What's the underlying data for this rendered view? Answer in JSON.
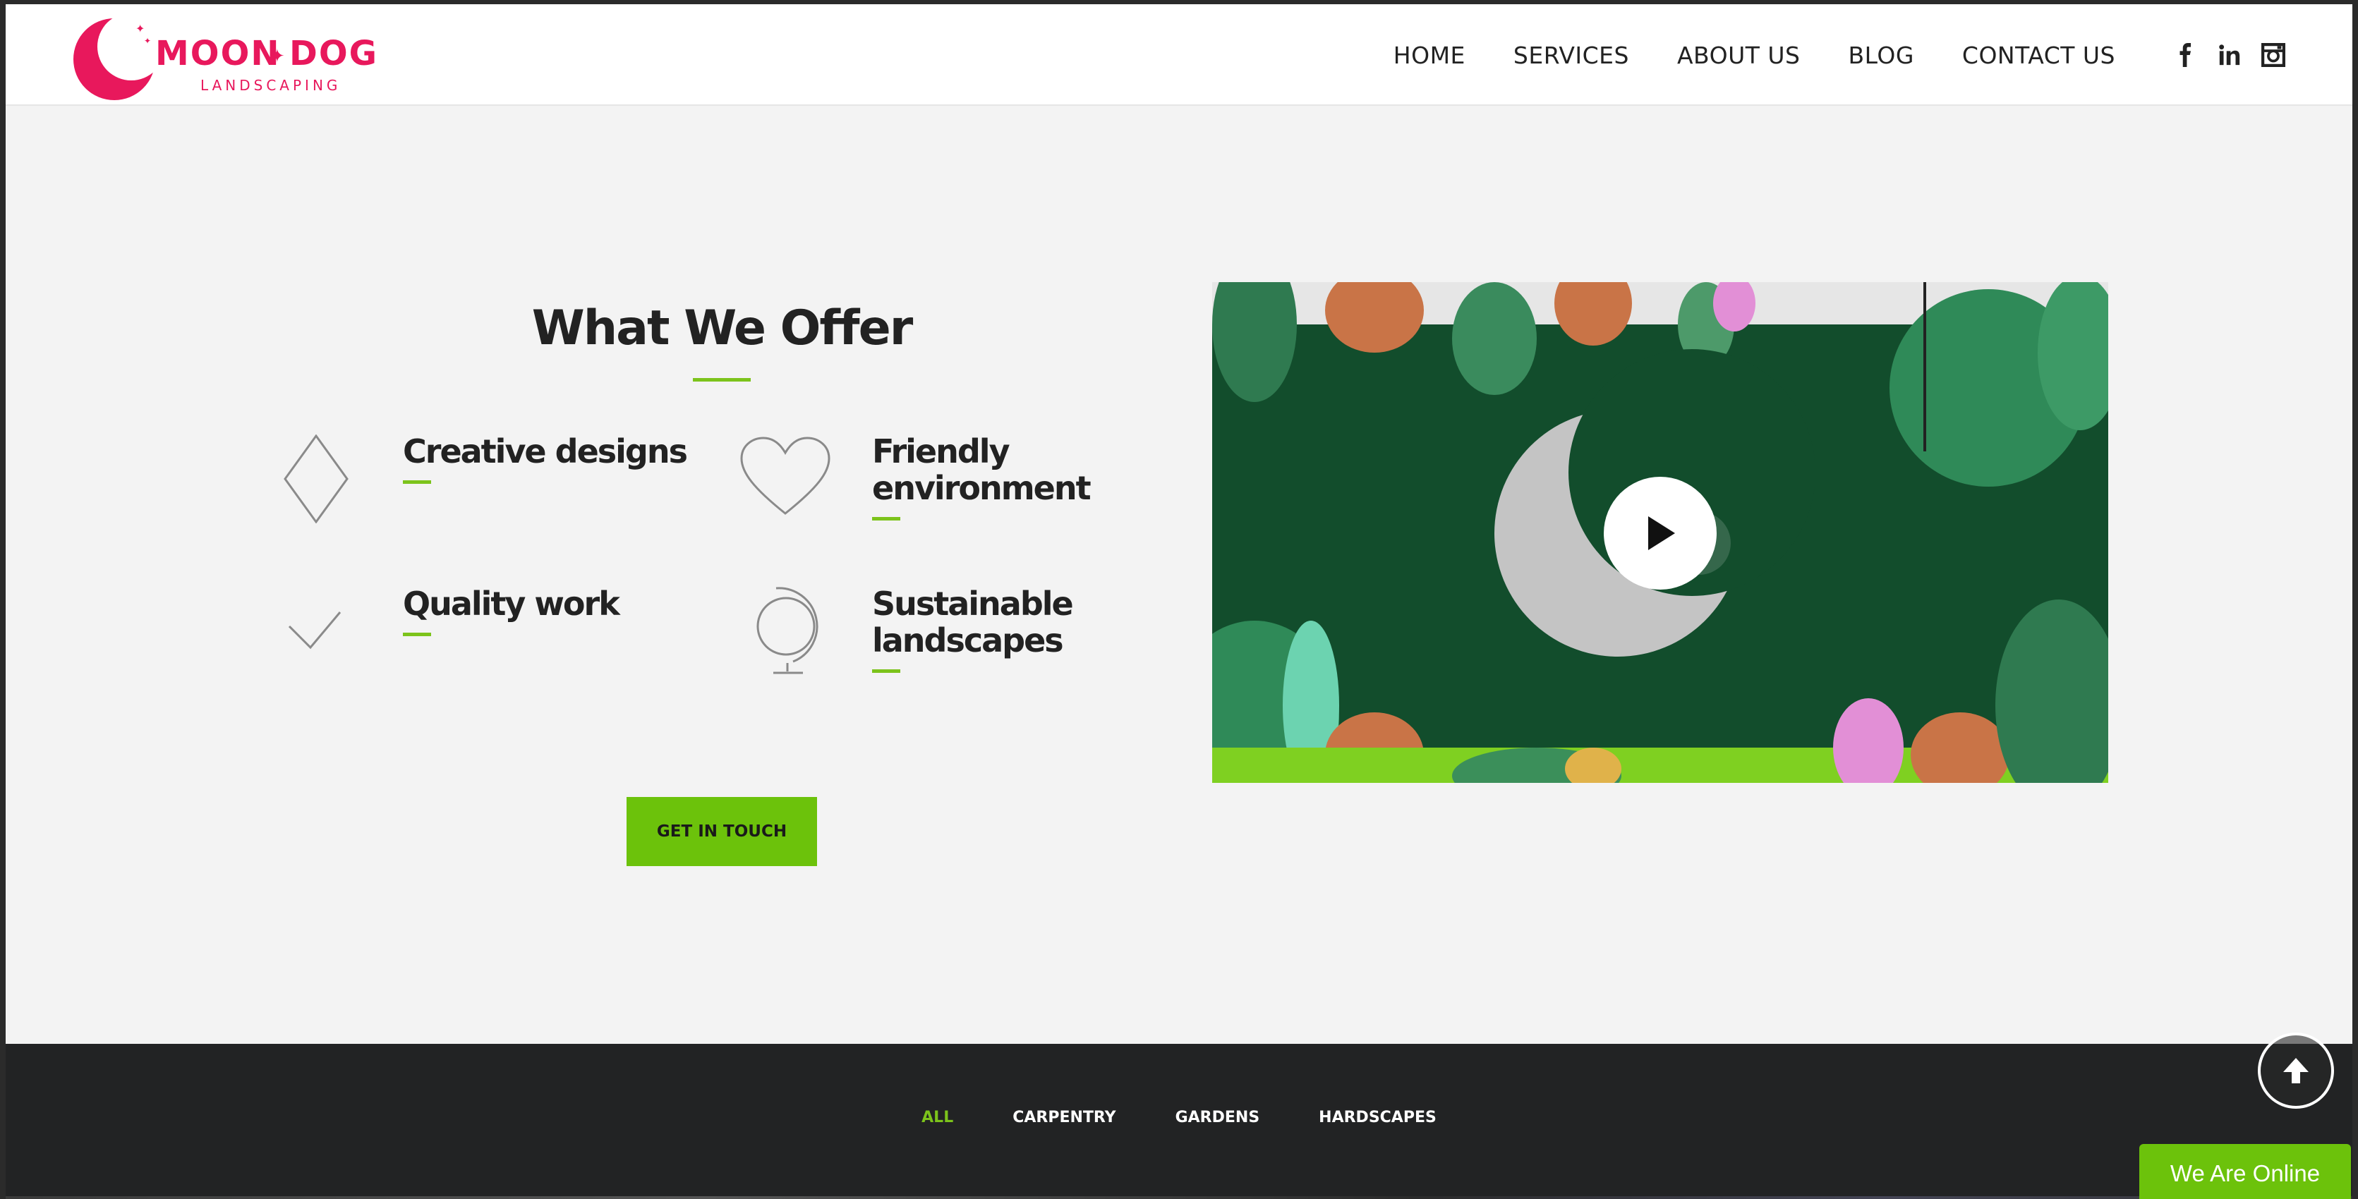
{
  "brand": {
    "name_left": "MOON",
    "name_right": "DOG",
    "tagline": "LANDSCAPING",
    "color": "#e8185c"
  },
  "nav": {
    "items": [
      "HOME",
      "SERVICES",
      "ABOUT US",
      "BLOG",
      "CONTACT US"
    ],
    "social": [
      "facebook-icon",
      "linkedin-icon",
      "instagram-icon"
    ]
  },
  "offer": {
    "title": "What We Offer",
    "features": [
      {
        "title": "Creative designs",
        "icon": "diamond-icon"
      },
      {
        "title": "Friendly environment",
        "icon": "heart-icon"
      },
      {
        "title": "Quality work",
        "icon": "check-icon"
      },
      {
        "title": "Sustainable landscapes",
        "icon": "globe-icon"
      }
    ],
    "cta": "GET IN TOUCH",
    "accent": "#7cc31b"
  },
  "video": {
    "play_icon": "play-icon"
  },
  "portfolio": {
    "filters": [
      "ALL",
      "CARPENTRY",
      "GARDENS",
      "HARDSCAPES"
    ],
    "active_filter": "ALL"
  },
  "widgets": {
    "scroll_top_icon": "arrow-up-icon",
    "chat_label": "We Are Online"
  }
}
